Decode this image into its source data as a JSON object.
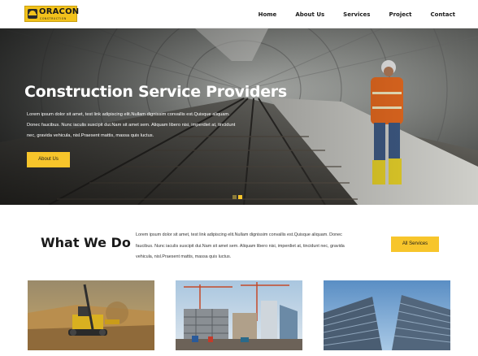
{
  "header": {
    "logo": {
      "title": "ORACON",
      "subtitle": "CONSTRUCTION"
    },
    "nav": [
      "Home",
      "About Us",
      "Services",
      "Project",
      "Contact"
    ]
  },
  "hero": {
    "title": "Construction Service Providers",
    "lines": [
      "Lorem ipsum dolor sit amet, test link adipiscing elit.Nullam dignissim convallis est.Quisque aliquam.",
      "Donec faucibus. Nunc iaculis suscipit dui.Nam sit amet sem. Aliquam libero nisi, imperdiet at, tincidunt",
      "nec, gravida vehicula, nisl.Praesent mattis, massa quis luctus."
    ],
    "button": "About Us",
    "slides": {
      "total": 2,
      "active": 2
    }
  },
  "what_we_do": {
    "title": "What We Do",
    "lines": [
      "Lorem ipsum dolor sit amet, test link adipiscing elit.Nullam dignissim convallis est.Quisque aliquam. Donec",
      "faucibus. Nunc iaculis suscipit dui.Nam sit amet sem. Aliquam libero nisi, imperdiet at, tincidunt nec, gravida",
      "vehicula, nisl.Praesent mattis, massa quis luctus."
    ],
    "button": "All Services"
  },
  "cards": [
    {
      "image": "drilling-rig-photo"
    },
    {
      "image": "construction-site-cranes-photo"
    },
    {
      "image": "high-rise-buildings-photo"
    }
  ],
  "colors": {
    "accent": "#f7c52b",
    "text": "#1a1a1a"
  }
}
